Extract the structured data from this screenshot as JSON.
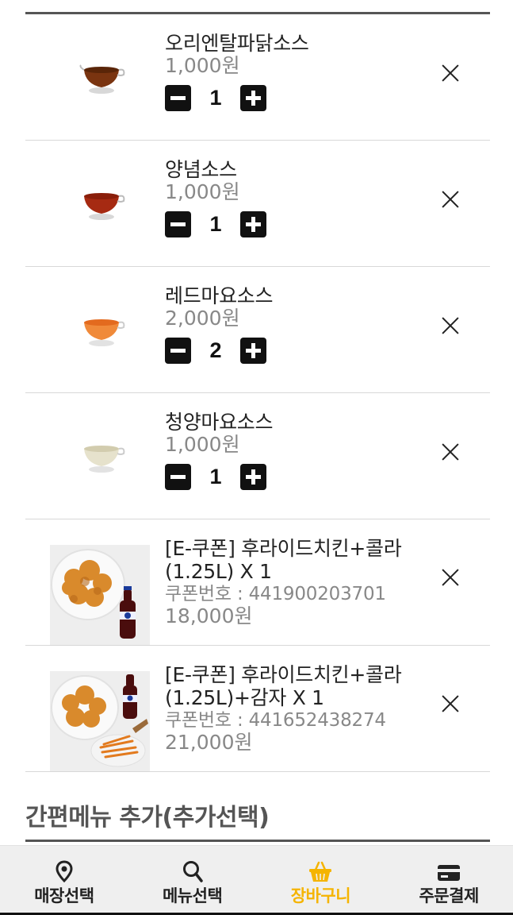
{
  "cart": {
    "items": [
      {
        "name": "오리엔탈파닭소스",
        "price": "1,000원",
        "qty": "1",
        "image": "oriental-sauce-cup"
      },
      {
        "name": "양념소스",
        "price": "1,000원",
        "qty": "1",
        "image": "yangnyeom-sauce-cup"
      },
      {
        "name": "레드마요소스",
        "price": "2,000원",
        "qty": "2",
        "image": "red-mayo-sauce-cup"
      },
      {
        "name": "청양마요소스",
        "price": "1,000원",
        "qty": "1",
        "image": "cheongyang-mayo-sauce-cup"
      }
    ],
    "coupons": [
      {
        "name_line1": "[E-쿠폰] 후라이드치킨+콜라",
        "name_line2": "(1.25L) X 1",
        "coupon_no": "쿠폰번호 : 441900203701",
        "price": "18,000원",
        "image": "fried-chicken-cola-photo"
      },
      {
        "name_line1": "[E-쿠폰] 후라이드치킨+콜라",
        "name_line2": "(1.25L)+감자 X 1",
        "coupon_no": "쿠폰번호 : 441652438274",
        "price": "21,000원",
        "image": "fried-chicken-cola-fries-photo"
      }
    ]
  },
  "quick_menu": {
    "title": "간편메뉴 추가(추가선택)"
  },
  "tabbar": {
    "store": "매장선택",
    "menu": "메뉴선택",
    "basket": "장바구니",
    "checkout": "주문결제",
    "active": "basket",
    "active_color": "#f5b400"
  }
}
